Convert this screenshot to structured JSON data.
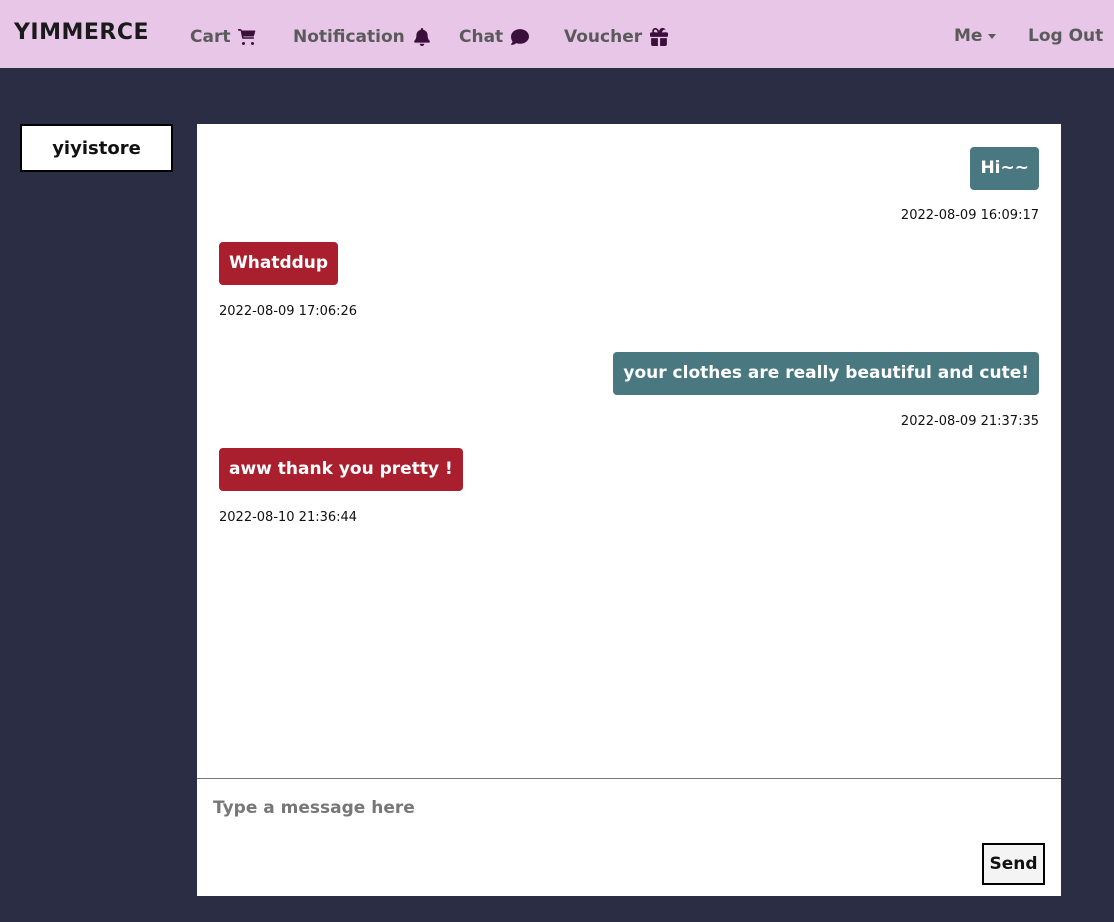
{
  "navbar": {
    "brand": "YIMMERCE",
    "links": [
      {
        "label": "Cart",
        "icon": "cart-icon"
      },
      {
        "label": "Notification",
        "icon": "bell-icon"
      },
      {
        "label": "Chat",
        "icon": "chat-bubble-icon"
      },
      {
        "label": "Voucher",
        "icon": "gift-icon"
      }
    ],
    "me_label": "Me",
    "logout_label": "Log Out",
    "icon_color": "#3b0f3b",
    "background": "#e8c6e8"
  },
  "contacts": [
    {
      "name": "yiyistore"
    }
  ],
  "chat": {
    "messages": [
      {
        "sender": "me",
        "text": "Hi~~",
        "timestamp": "2022-08-09 16:09:17"
      },
      {
        "sender": "them",
        "text": "Whatddup",
        "timestamp": "2022-08-09 17:06:26"
      },
      {
        "sender": "me",
        "text": "your clothes are really beautiful and cute!",
        "timestamp": "2022-08-09 21:37:35"
      },
      {
        "sender": "them",
        "text": "aww thank you pretty !",
        "timestamp": "2022-08-10 21:36:44"
      }
    ],
    "input_placeholder": "Type a message here",
    "send_label": "Send",
    "colors": {
      "my_bubble": "#497880",
      "their_bubble": "#aa1f2e",
      "page_background": "#2a2d44"
    }
  }
}
